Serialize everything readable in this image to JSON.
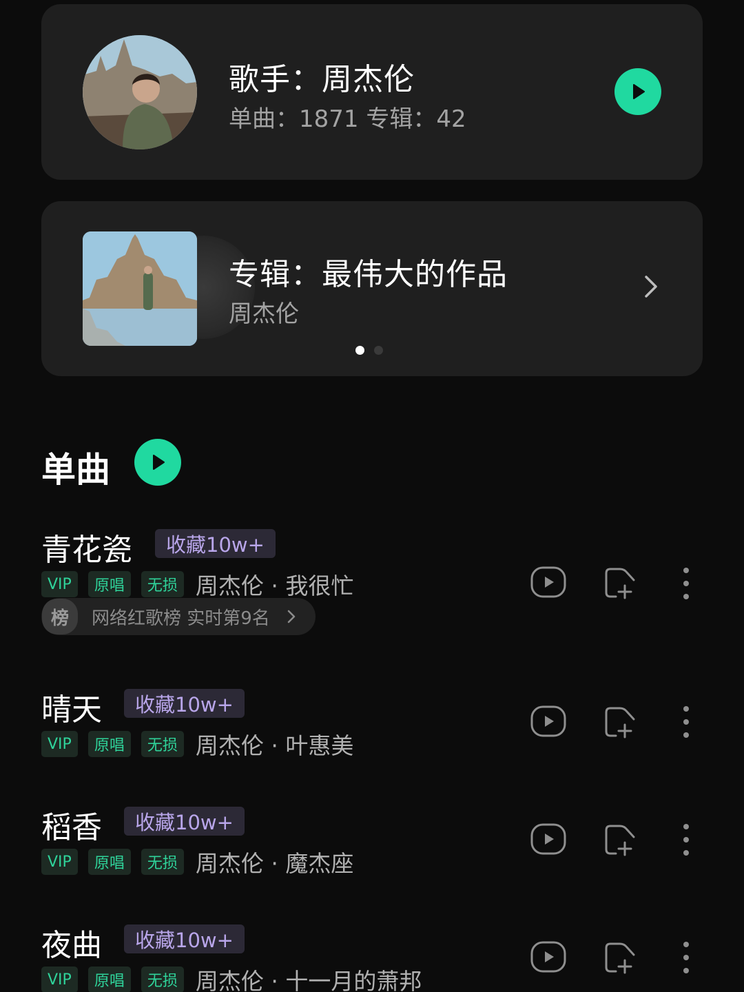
{
  "artist_card": {
    "title": "歌手：周杰伦",
    "subtitle": "单曲：1871 专辑：42"
  },
  "album_card": {
    "title": "专辑：最伟大的作品",
    "artist": "周杰伦",
    "carousel_total": 2,
    "carousel_active": 1
  },
  "section": {
    "title": "单曲"
  },
  "songs": [
    {
      "title": "青花瓷",
      "fav": "收藏10w+",
      "tags": [
        "VIP",
        "原唱",
        "无损"
      ],
      "meta": "周杰伦 · 我很忙",
      "rank_badge": "榜",
      "rank_text": "网络红歌榜 实时第9名"
    },
    {
      "title": "晴天",
      "fav": "收藏10w+",
      "tags": [
        "VIP",
        "原唱",
        "无损"
      ],
      "meta": "周杰伦 · 叶惠美"
    },
    {
      "title": "稻香",
      "fav": "收藏10w+",
      "tags": [
        "VIP",
        "原唱",
        "无损"
      ],
      "meta": "周杰伦 · 魔杰座"
    },
    {
      "title": "夜曲",
      "fav": "收藏10w+",
      "tags": [
        "VIP",
        "原唱",
        "无损"
      ],
      "meta": "周杰伦 · 十一月的萧邦"
    }
  ],
  "colors": {
    "accent": "#20d9a0",
    "background": "#0c0c0c",
    "card": "#1f1f1f",
    "tag_text": "#2fd39a",
    "fav_text": "#b9a6ea"
  },
  "icons": {
    "play": "play-icon",
    "add_to_playlist": "add-to-playlist-icon",
    "more": "more-vertical-icon",
    "chevron": "chevron-right-icon"
  }
}
